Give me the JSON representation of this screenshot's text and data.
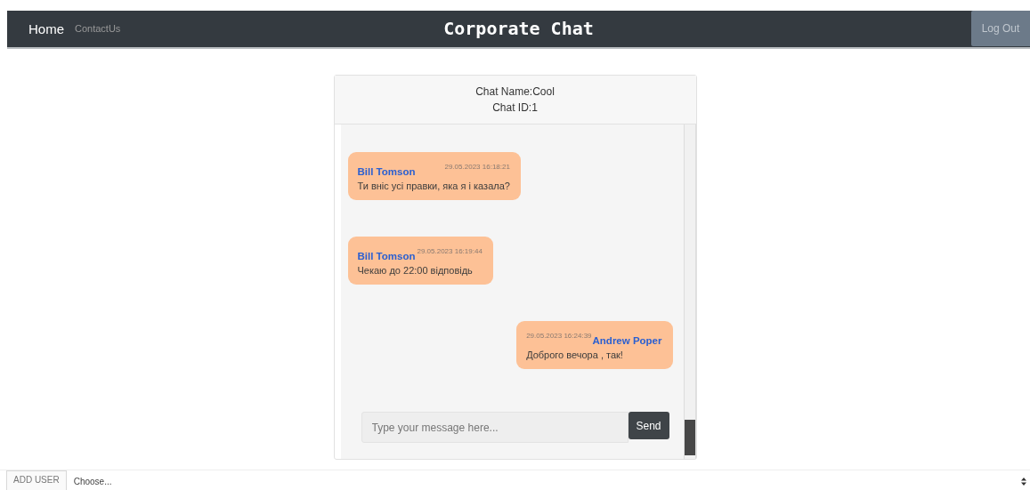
{
  "navbar": {
    "links": [
      {
        "label": "Home",
        "selected": true
      },
      {
        "label": "ContactUs",
        "selected": false
      }
    ],
    "title": "Corporate Chat",
    "logout": "Log Out"
  },
  "chat": {
    "name_line": "Chat Name:Cool",
    "id_line": "Chat ID:1",
    "messages": [
      {
        "kind": "incoming",
        "author": "Bill Tomson",
        "time": "29.05.2023 16:18:21",
        "text": "Ти вніс усі правки, яка я і казала?"
      },
      {
        "kind": "incoming",
        "author": "Bill Tomson",
        "time": "29.05.2023 16:19:44",
        "text": "Чекаю до 22:00 відповідь"
      },
      {
        "kind": "outgoing",
        "author": "Andrew Poper",
        "time": "29.05.2023 16:24:39",
        "text": "Доброго вечора , так!"
      }
    ],
    "input": {
      "placeholder": "Type your message here..."
    },
    "send": "Send"
  },
  "add_user": {
    "label": "ADD USER",
    "select": "Choose..."
  }
}
